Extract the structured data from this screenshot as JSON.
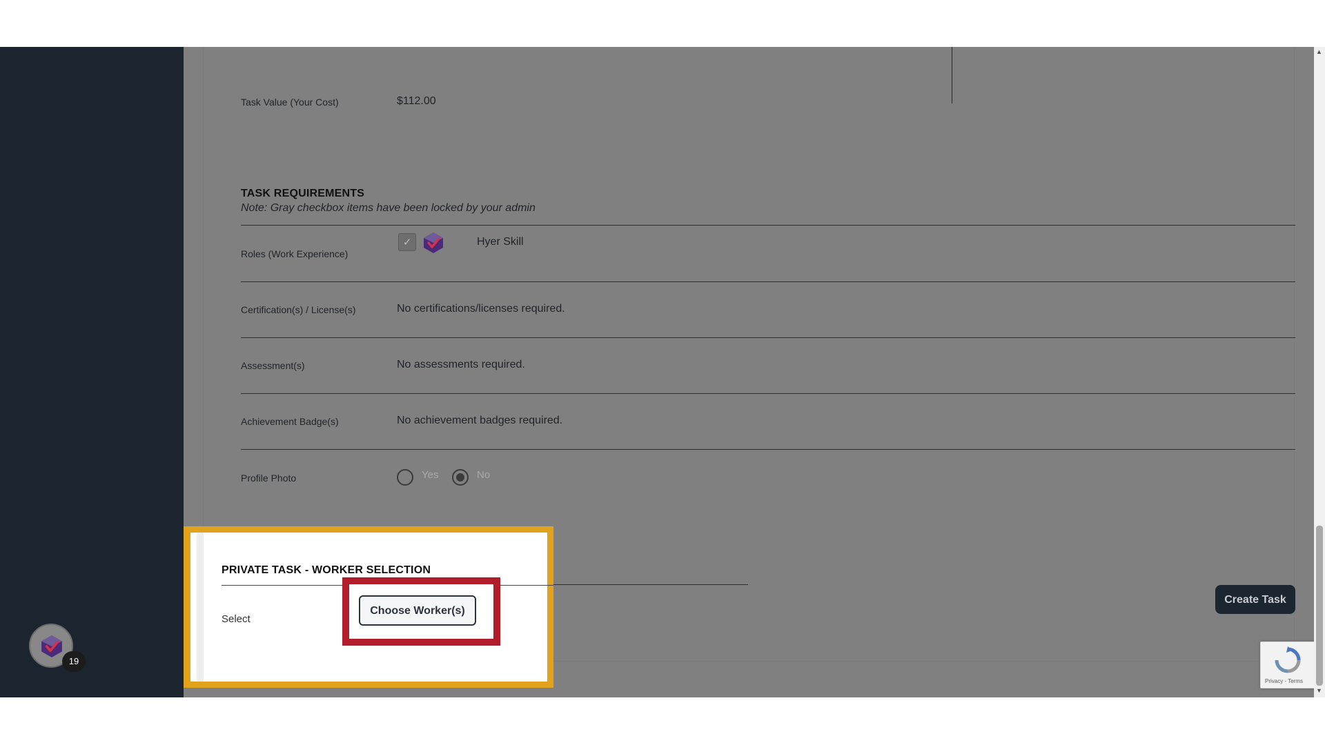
{
  "task_value": {
    "label": "Task Value (Your Cost)",
    "value": "$112.00"
  },
  "requirements": {
    "title": "TASK REQUIREMENTS",
    "note": "Note: Gray checkbox items have been locked by your admin",
    "roles": {
      "label": "Roles (Work Experience)",
      "skill": "Hyer Skill"
    },
    "certifications": {
      "label": "Certification(s) / License(s)",
      "value": "No certifications/licenses required."
    },
    "assessments": {
      "label": "Assessment(s)",
      "value": "No assessments required."
    },
    "badges": {
      "label": "Achievement Badge(s)",
      "value": "No achievement badges required."
    },
    "profile_photo": {
      "label": "Profile Photo",
      "option_yes": "Yes",
      "option_no": "No",
      "selected": "No"
    }
  },
  "private_task": {
    "title": "PRIVATE TASK - WORKER SELECTION",
    "select_label": "Select",
    "choose_button": "Choose Worker(s)"
  },
  "actions": {
    "create_task": "Create Task"
  },
  "recaptcha": {
    "text": "Privacy - Terms"
  },
  "notifications": {
    "count": "19"
  },
  "colors": {
    "sidebar": "#1c242f",
    "overlay": "#808080",
    "highlight_outer": "#e2a21c",
    "highlight_inner": "#b21d2c",
    "brand_icon_purple": "#4b2a7a",
    "brand_icon_red": "#d4314a"
  }
}
